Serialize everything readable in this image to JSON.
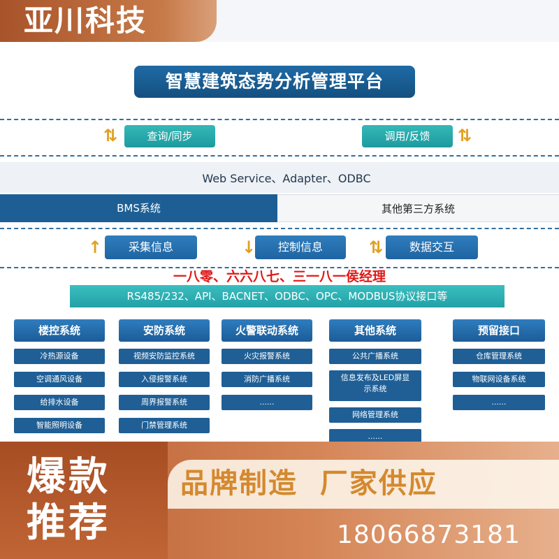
{
  "brand": "亚川科技",
  "diagram": {
    "title": "智慧建筑态势分析管理平台",
    "query_sync": "查询/同步",
    "call_feedback": "调用/反馈",
    "interfaces": "Web Service、Adapter、ODBC",
    "bms": "BMS系统",
    "third_party": "其他第三方系统",
    "collect": "采集信息",
    "control": "控制信息",
    "exchange": "数据交互",
    "red_note": "一八零、六六八七、三一八一侯经理",
    "protocols": "RS485/232、API、BACNET、ODBC、OPC、MODBUS协议接口等",
    "columns": [
      {
        "title": "楼控系统",
        "items": [
          "冷热源设备",
          "空调通风设备",
          "给排水设备",
          "智能照明设备"
        ]
      },
      {
        "title": "安防系统",
        "items": [
          "视频安防监控系统",
          "入侵报警系统",
          "周界报警系统",
          "门禁管理系统"
        ]
      },
      {
        "title": "火警联动系统",
        "items": [
          "火灾报警系统",
          "消防广播系统",
          "......"
        ]
      },
      {
        "title": "其他系统",
        "items": [
          "公共广播系统",
          "信息发布及LED屏显示系统",
          "网络管理系统",
          "......"
        ]
      },
      {
        "title": "预留接口",
        "items": [
          "仓库管理系统",
          "物联网设备系统",
          "......"
        ]
      }
    ]
  },
  "promo": {
    "hot_line1": "爆款",
    "hot_line2": "推荐",
    "slogan": "品牌制造  厂家供应",
    "phone": "18066873181"
  },
  "colors": {
    "brand_orange": "#b85c30",
    "diagram_blue": "#1d5f95",
    "teal": "#22a1a6",
    "red_note": "#e01818"
  }
}
